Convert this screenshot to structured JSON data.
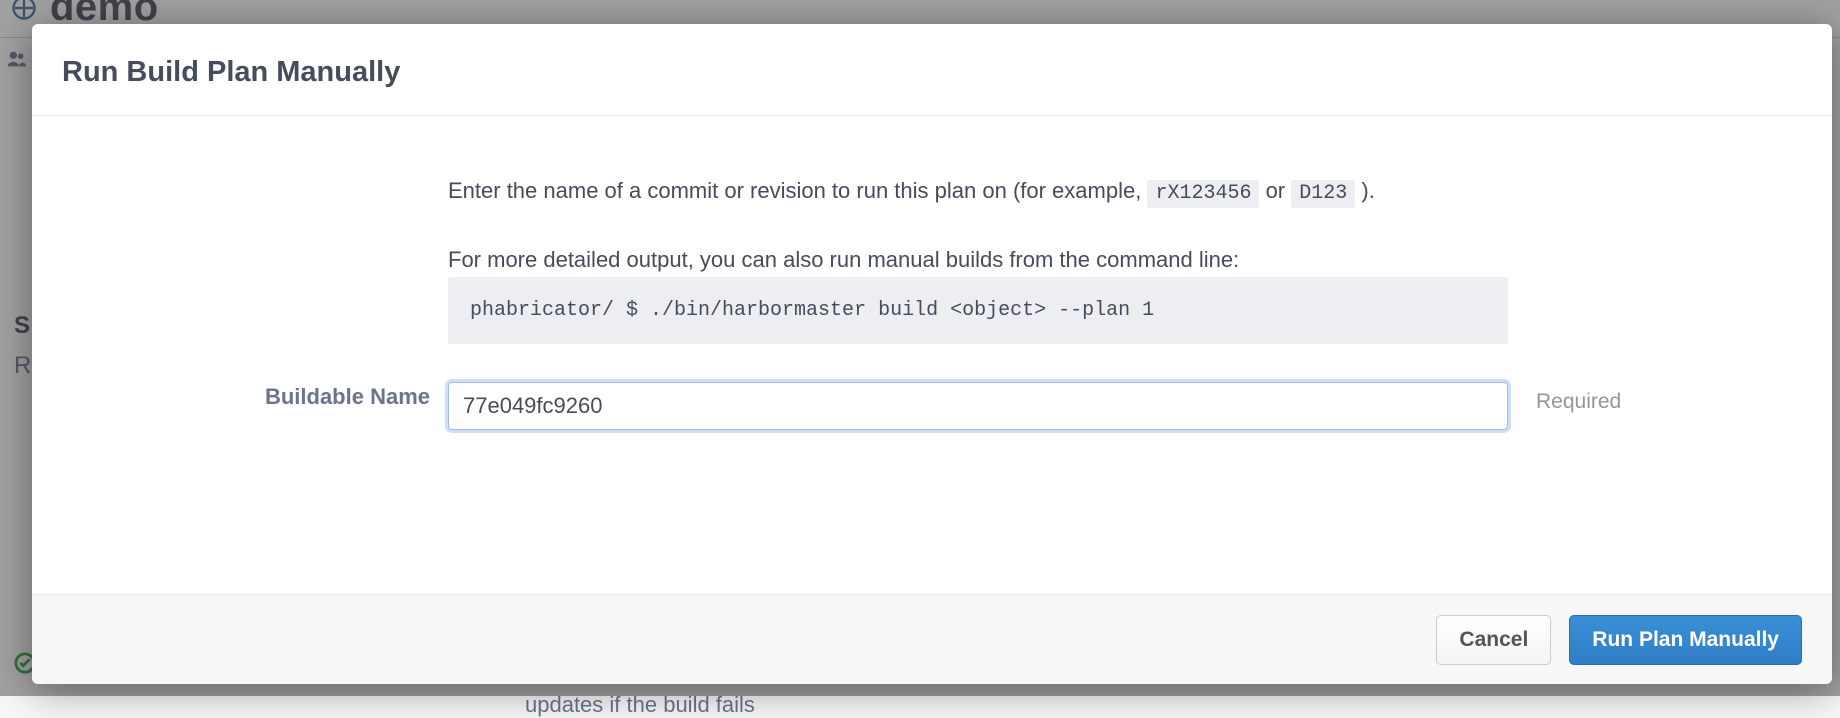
{
  "background": {
    "page_name": "demo",
    "side_s": "S",
    "side_r": "R",
    "footer_fragment": "updates if the build fails"
  },
  "modal": {
    "title": "Run Build Plan Manually",
    "instructions": {
      "line1_pre": "Enter the name of a commit or revision to run this plan on (for example, ",
      "example1": "rX123456",
      "line1_mid": " or ",
      "example2": "D123",
      "line1_post": " ).",
      "line2": "For more detailed output, you can also run manual builds from the command line:",
      "command": "phabricator/ $ ./bin/harbormaster build <object> --plan 1"
    },
    "form": {
      "buildable_name_label": "Buildable Name",
      "buildable_name_value": "77e049fc9260",
      "required_text": "Required"
    },
    "buttons": {
      "cancel": "Cancel",
      "submit": "Run Plan Manually"
    }
  }
}
